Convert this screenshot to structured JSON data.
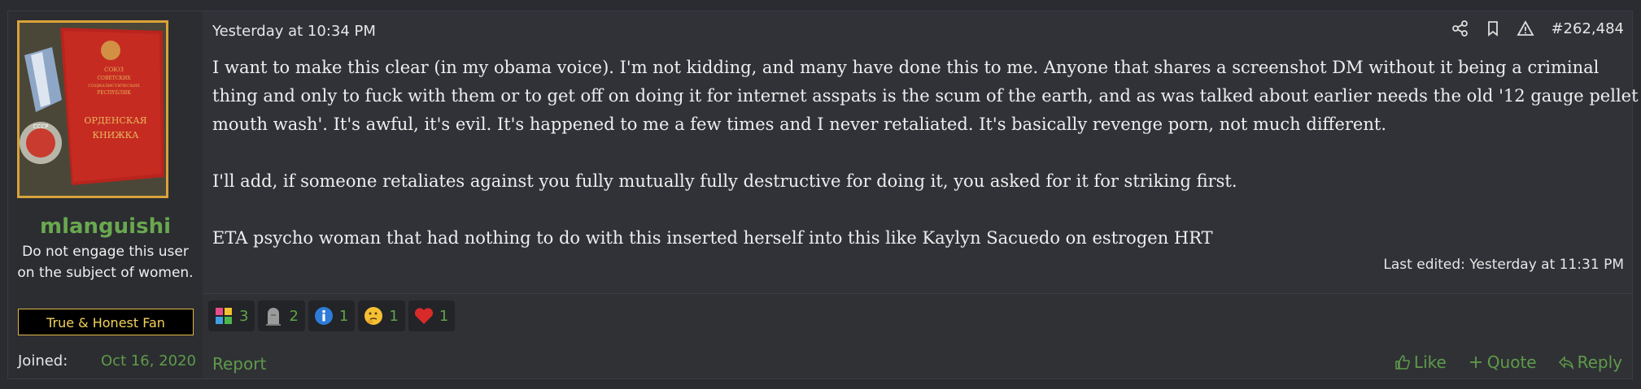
{
  "user": {
    "username": "mlanguishi",
    "title": "Do not engage this user on the subject of women.",
    "banner": "True & Honest Fan",
    "joined_label": "Joined:",
    "joined_value": "Oct 16, 2020",
    "avatar_text": [
      "СОЮЗ",
      "СОВЕТСКИХ",
      "СОЦИАЛИСТИЧЕСКИХ",
      "РЕСПУБЛИК",
      "ОРДЕНСКАЯ",
      "КНИЖКА"
    ],
    "medal_text": "СССР"
  },
  "post": {
    "time": "Yesterday at 10:34 PM",
    "number": "#262,484",
    "paragraphs": [
      "I want to make this clear (in my obama voice). I'm not kidding, and many have done this to me. Anyone that shares a screenshot DM without it being a criminal thing and only to fuck with them or to get off on doing it for internet asspats is the scum of the earth, and as was talked about earlier needs the old '12 gauge pellet mouth wash'. It's awful, it's evil. It's happened to me a few times and I never retaliated. It's basically revenge porn, not much different.",
      "I'll add, if someone retaliates against you fully mutually fully destructive for doing it, you asked for it for striking first.",
      "ETA psycho woman that had nothing to do with this inserted herself into this like Kaylyn Sacuedo on estrogen HRT"
    ],
    "last_edited": "Last edited: Yesterday at 11:31 PM"
  },
  "top_actions": {
    "icons": [
      "share-icon",
      "bookmark-icon",
      "warning-icon"
    ]
  },
  "reactions": [
    {
      "icon": "autism-puzzle-icon",
      "count": "3"
    },
    {
      "icon": "tombstone-icon",
      "count": "2"
    },
    {
      "icon": "informative-icon",
      "count": "1"
    },
    {
      "icon": "thinking-face-icon",
      "count": "1"
    },
    {
      "icon": "heart-icon",
      "count": "1"
    }
  ],
  "footer": {
    "report": "Report",
    "like": "Like",
    "quote": "Quote",
    "reply": "Reply"
  },
  "colors": {
    "accent_green": "#5f9a4a",
    "username_green": "#6aa84f",
    "banner_border": "#e0b94a",
    "background": "#2a2c31"
  }
}
